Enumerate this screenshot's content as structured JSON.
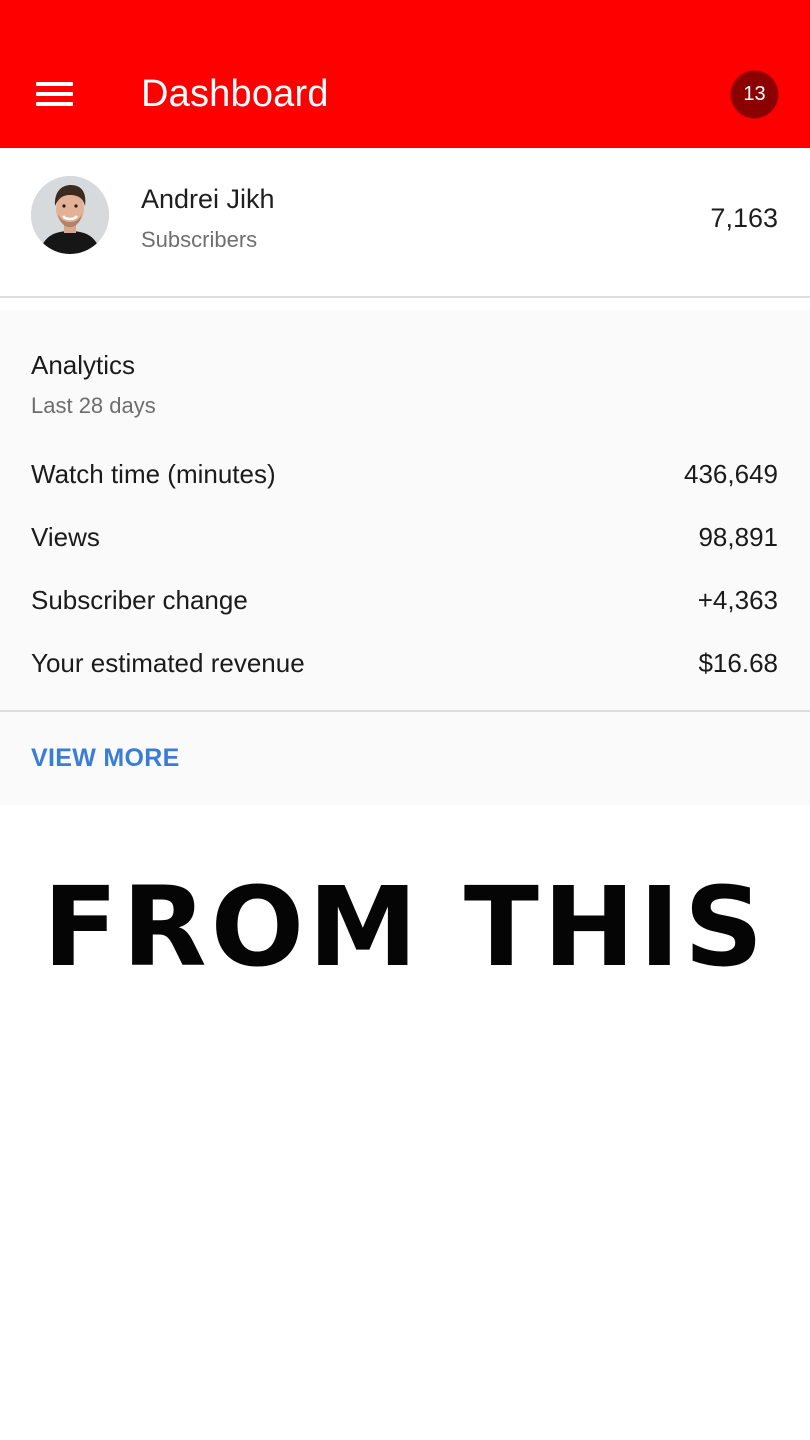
{
  "app_bar": {
    "title": "Dashboard",
    "notification_count": "13",
    "background_color": "#ff0000",
    "menu_icon": "hamburger-menu-icon"
  },
  "channel": {
    "name": "Andrei Jikh",
    "subscribers_label": "Subscribers",
    "subscribers_count": "7,163",
    "avatar": "profile-photo"
  },
  "analytics": {
    "title": "Analytics",
    "period": "Last 28 days",
    "metrics": [
      {
        "label": "Watch time (minutes)",
        "value": "436,649"
      },
      {
        "label": "Views",
        "value": "98,891"
      },
      {
        "label": "Subscriber change",
        "value": "+4,363"
      },
      {
        "label": "Your estimated revenue",
        "value": "$16.68"
      }
    ],
    "view_more_label": "VIEW MORE",
    "link_color": "#3a7dd8"
  },
  "caption": {
    "text": "FROM THIS"
  }
}
